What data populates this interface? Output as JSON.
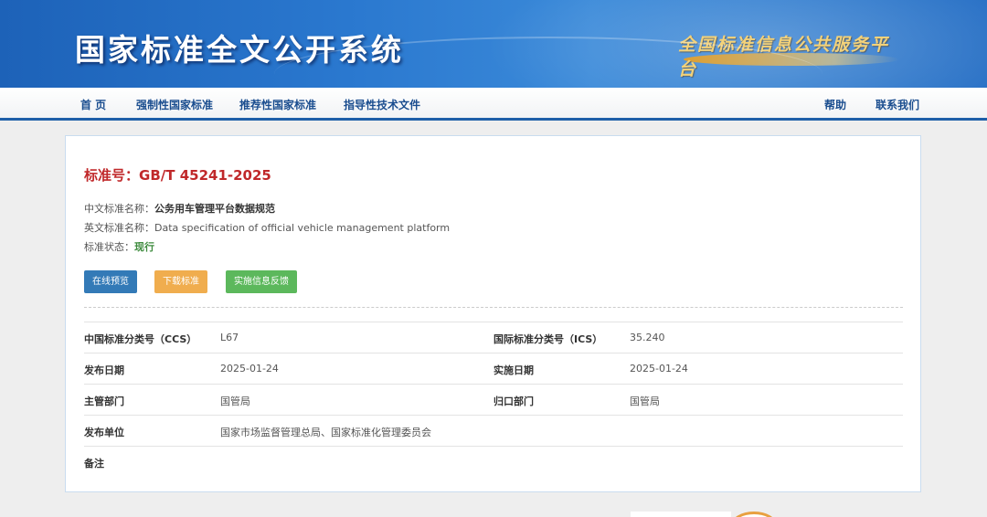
{
  "header": {
    "site_title": "国家标准全文公开系统",
    "platform_name": "全国标准信息公共服务平台"
  },
  "nav": {
    "left": [
      "首 页",
      "强制性国家标准",
      "推荐性国家标准",
      "指导性技术文件"
    ],
    "right": [
      "帮助",
      "联系我们"
    ]
  },
  "standard": {
    "number_label": "标准号：",
    "number": "GB/T 45241-2025",
    "cn_name_label": "中文标准名称：",
    "cn_name": "公务用车管理平台数据规范",
    "en_name_label": "英文标准名称：",
    "en_name": "Data specification of official vehicle management platform",
    "status_label": "标准状态：",
    "status": "现行"
  },
  "buttons": {
    "preview": "在线预览",
    "download": "下载标准",
    "feedback": "实施信息反馈"
  },
  "info": {
    "ccs_label": "中国标准分类号（CCS）",
    "ccs": "L67",
    "ics_label": "国际标准分类号（ICS）",
    "ics": "35.240",
    "publish_date_label": "发布日期",
    "publish_date": "2025-01-24",
    "implement_date_label": "实施日期",
    "implement_date": "2025-01-24",
    "dept_label": "主管部门",
    "dept": "国管局",
    "owner_label": "归口部门",
    "owner": "国管局",
    "issuer_label": "发布单位",
    "issuer": "国家市场监督管理总局、国家标准化管理委员会",
    "remark_label": "备注",
    "remark": ""
  },
  "colors": {
    "banner": "#2a78cf",
    "nav_border": "#1d5ea8",
    "standard_number": "#c0282a",
    "status": "#3c8a3c",
    "btn_blue": "#337ab7",
    "btn_orange": "#f0ad4e",
    "btn_green": "#5cb85c"
  }
}
